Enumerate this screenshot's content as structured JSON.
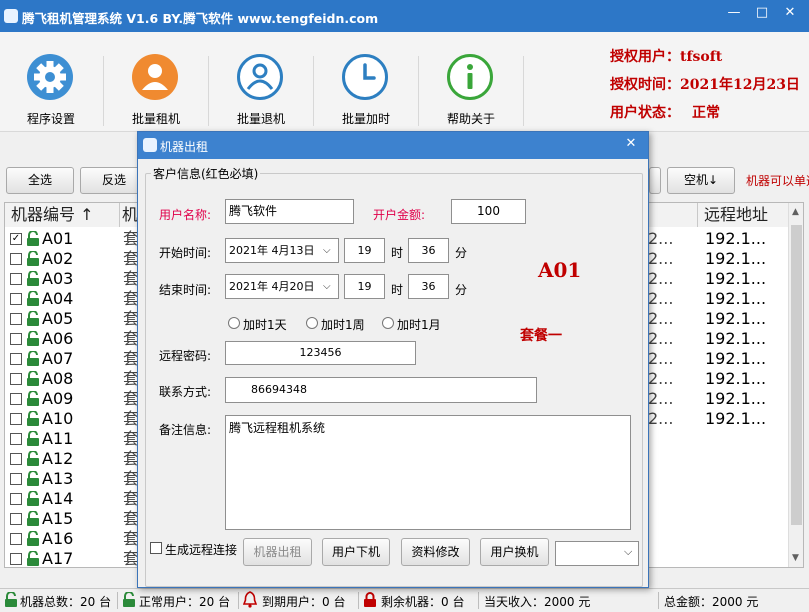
{
  "window": {
    "title": "腾飞租机管理系统 V1.6 BY.腾飞软件  www.tengfeidn.com",
    "minimize": "—",
    "maximize": "□",
    "close": "✕"
  },
  "toolbar": {
    "items": [
      {
        "label": "程序设置",
        "icon": "gear-icon",
        "color": "#3d8fd3"
      },
      {
        "label": "批量租机",
        "icon": "user-icon",
        "color": "#f08a30"
      },
      {
        "label": "批量退机",
        "icon": "user-outline-icon",
        "color": "#2d7fc1"
      },
      {
        "label": "批量加时",
        "icon": "clock-icon",
        "color": "#2d7fc1"
      },
      {
        "label": "帮助关于",
        "icon": "info-icon",
        "color": "#3aa63a"
      }
    ]
  },
  "auth": {
    "user": "授权用户：tfsoft",
    "time": "授权时间：2021年12月23日",
    "status_label": "用户状态：",
    "status_value": "正常"
  },
  "actions": {
    "select_all": "全选",
    "invert": "反选",
    "idle": "空机↓",
    "hint": "机器可以单选"
  },
  "grid": {
    "col_code": "机器编号 ↑",
    "col_2": "机",
    "col_remote": "远程地址",
    "rows": [
      {
        "code": "A01",
        "checked": true,
        "c2": "套",
        "c3": "2...",
        "c4": "192.1..."
      },
      {
        "code": "A02",
        "checked": false,
        "c2": "套",
        "c3": "2...",
        "c4": "192.1..."
      },
      {
        "code": "A03",
        "checked": false,
        "c2": "套",
        "c3": "2...",
        "c4": "192.1..."
      },
      {
        "code": "A04",
        "checked": false,
        "c2": "套",
        "c3": "2...",
        "c4": "192.1..."
      },
      {
        "code": "A05",
        "checked": false,
        "c2": "套",
        "c3": "2...",
        "c4": "192.1..."
      },
      {
        "code": "A06",
        "checked": false,
        "c2": "套",
        "c3": "2...",
        "c4": "192.1..."
      },
      {
        "code": "A07",
        "checked": false,
        "c2": "套",
        "c3": "2...",
        "c4": "192.1..."
      },
      {
        "code": "A08",
        "checked": false,
        "c2": "套",
        "c3": "2...",
        "c4": "192.1..."
      },
      {
        "code": "A09",
        "checked": false,
        "c2": "套",
        "c3": "2...",
        "c4": "192.1..."
      },
      {
        "code": "A10",
        "checked": false,
        "c2": "套",
        "c3": "2...",
        "c4": "192.1..."
      },
      {
        "code": "A11",
        "checked": false,
        "c2": "套",
        "c3": "",
        "c4": ""
      },
      {
        "code": "A12",
        "checked": false,
        "c2": "套",
        "c3": "",
        "c4": ""
      },
      {
        "code": "A13",
        "checked": false,
        "c2": "套",
        "c3": "",
        "c4": ""
      },
      {
        "code": "A14",
        "checked": false,
        "c2": "套",
        "c3": "",
        "c4": ""
      },
      {
        "code": "A15",
        "checked": false,
        "c2": "套",
        "c3": "",
        "c4": ""
      },
      {
        "code": "A16",
        "checked": false,
        "c2": "套",
        "c3": "",
        "c4": ""
      },
      {
        "code": "A17",
        "checked": false,
        "c2": "套",
        "c3": "",
        "c4": ""
      }
    ]
  },
  "status": {
    "total": "机器总数：20 台",
    "normal": "正常用户：20 台",
    "expired": "到期用户：0 台",
    "remaining": "剩余机器：0 台",
    "income": "当天收入：2000 元",
    "amount": "总金额：2000 元"
  },
  "dialog": {
    "title": "机器出租",
    "close": "✕",
    "group": "客户信息(红色必填)",
    "user_name_label": "用户名称:",
    "user_name": "腾飞软件",
    "amount_label": "开户金额:",
    "amount": "100",
    "start_label": "开始时间:",
    "start_date": "2021年  4月13日",
    "start_hour": "19",
    "start_min": "36",
    "hour_unit": "时",
    "min_unit": "分",
    "end_label": "结束时间:",
    "end_date": "2021年  4月20日",
    "end_hour": "19",
    "end_min": "36",
    "machine": "A01",
    "package": "套餐一",
    "add_day": "加时1天",
    "add_week": "加时1周",
    "add_month": "加时1月",
    "pwd_label": "远程密码:",
    "pwd": "123456",
    "contact_label": "联系方式:",
    "contact": "86694348",
    "note_label": "备注信息:",
    "note": "腾飞远程租机系统",
    "gen_remote": "生成远程连接",
    "btn_rent": "机器出租",
    "btn_offline": "用户下机",
    "btn_edit": "资料修改",
    "btn_switch": "用户换机"
  }
}
